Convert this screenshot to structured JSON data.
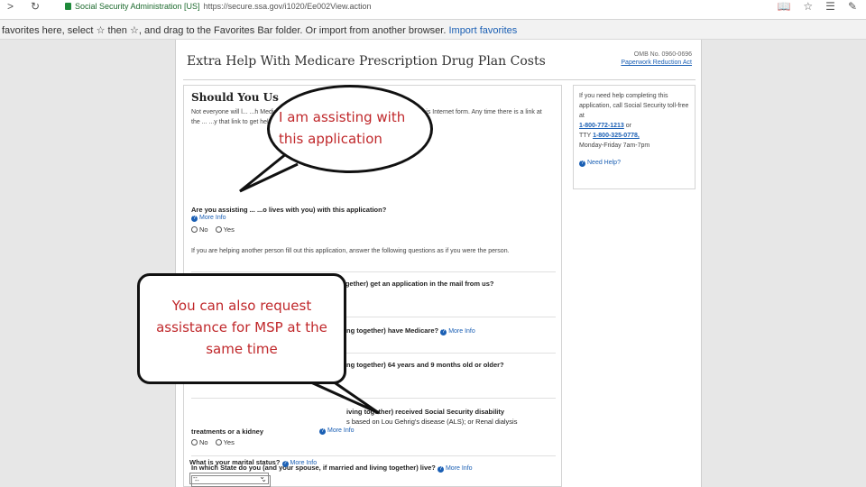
{
  "browser": {
    "nav": {
      "back": ">",
      "refresh": "↻"
    },
    "site_name": "Social Security Administration [US]",
    "url": "https://secure.ssa.gov/i1020/Ee002View.action",
    "icons": [
      "reading-view-icon",
      "favorite-star-icon",
      "favorites-hub-icon",
      "notes-icon"
    ]
  },
  "favorites_bar": {
    "text_a": "favorites here, select",
    "star1": "☆",
    "text_b": "then",
    "star2": "☆,",
    "text_c": "and drag to the Favorites Bar folder. Or import from another browser.",
    "link": "Import favorites"
  },
  "page": {
    "title": "Extra Help With Medicare Prescription Drug Plan Costs",
    "omb_no": "OMB No. 0960-0696",
    "paperwork_link": "Paperwork Reduction Act",
    "heading": "Should You Us",
    "intro": "Not everyone will l... ...h Medicare Prescription Drug Plan Costs. You must ... ...se this Internet form. Any time there is a link at the ... ...y that link to get help with that question.",
    "more_info": "More Info",
    "radio_no": "No",
    "radio_yes": "Yes",
    "q1": "Are you assisting ... ...o lives with you) with this application?",
    "helper_note": "If you are helping another person fill out this application, answer the following questions as if you were the person.",
    "q2": "Did you (or your spouse, if married and living together) get an application in the mail from us?",
    "q3_tail": "ng together) have Medicare?",
    "q4_tail": "ng together) 64 years and 9 months old or older?",
    "q5_tail": "iving together) received Social Security disability",
    "q5_line2": "s based on Lou Gehrig's disease (ALS); or Renal dialysis",
    "q5_line3": "treatments or a kidney",
    "q6": "In which State do you (and your spouse, if married and living together) live?",
    "q7": "What is your marital status?",
    "select_value": "--"
  },
  "sidebar": {
    "text": "If you need help completing this application, call Social Security toll-free at",
    "phone": "1-800-772-1213",
    "or": "or",
    "tty_label": "TTY",
    "tty": "1-800-325-0778,",
    "hours": "Monday-Friday 7am-7pm",
    "need_help": "Need Help?"
  },
  "callouts": {
    "assist": "I am assisting with this application",
    "msp": "You can also request assistance for MSP at the same time"
  }
}
